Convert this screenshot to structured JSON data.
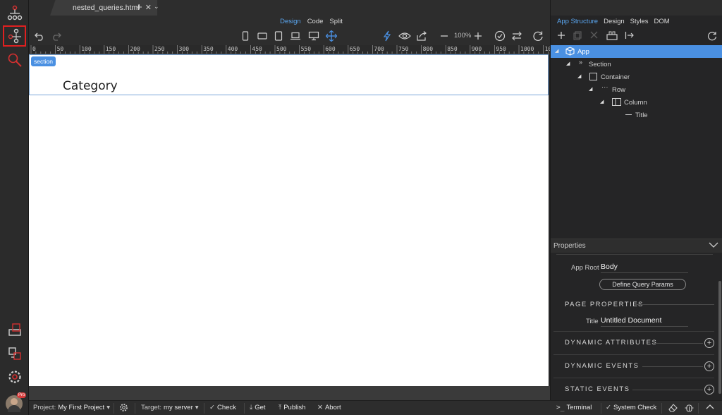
{
  "tabs": {
    "file_name": "nested_queries.html",
    "close_glyph": "✕",
    "add_glyph": "+",
    "menu_glyph": "⌄"
  },
  "view_modes": [
    "Design",
    "Code",
    "Split"
  ],
  "toolbar": {
    "zoom": "100%"
  },
  "ruler": {
    "labels": [
      "0",
      "50",
      "100",
      "150",
      "200",
      "250",
      "300",
      "350",
      "400",
      "450",
      "500",
      "550",
      "600",
      "650",
      "700",
      "750",
      "800",
      "850",
      "900",
      "950",
      "1000",
      "10"
    ]
  },
  "canvas": {
    "section_badge": "section",
    "category_title": "Category"
  },
  "right_panel": {
    "tabs": [
      "App Structure",
      "Design",
      "Styles",
      "DOM"
    ],
    "tree": [
      {
        "label": "App",
        "selected": true
      },
      {
        "label": "Section"
      },
      {
        "label": "Container"
      },
      {
        "label": "Row"
      },
      {
        "label": "Column"
      },
      {
        "label": "Title"
      }
    ],
    "properties": {
      "header": "Properties",
      "app_root_label": "App Root",
      "app_root_value": "Body",
      "define_query_params": "Define Query Params",
      "page_properties": "PAGE PROPERTIES",
      "title_label": "Title",
      "title_value": "Untitled Document",
      "dynamic_attributes": "DYNAMIC ATTRIBUTES",
      "dynamic_events": "DYNAMIC EVENTS",
      "static_events": "STATIC EVENTS"
    }
  },
  "statusbar": {
    "project_label": "Project:",
    "project_value": "My First Project",
    "target_label": "Target:",
    "target_value": "my server",
    "check": "Check",
    "get": "Get",
    "publish": "Publish",
    "abort": "Abort",
    "terminal": "Terminal",
    "system_check": "System Check"
  },
  "avatar_badge": "Pro",
  "colors": {
    "accent": "#4a90e2",
    "active_mode": "#5aa6f0",
    "highlight_border": "#e02020"
  }
}
